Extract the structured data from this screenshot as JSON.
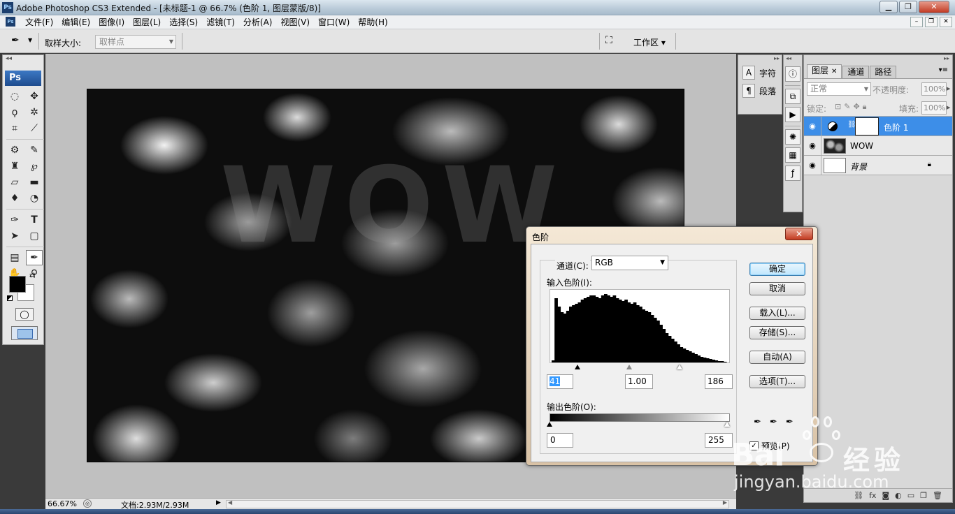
{
  "window": {
    "app_title": "Adobe Photoshop CS3 Extended - [未标题-1 @ 66.7% (色阶 1, 图层蒙版/8)]",
    "ps_logo": "Ps",
    "min": "▁",
    "max": "❐",
    "close": "✕"
  },
  "menu": {
    "items": [
      "文件(F)",
      "编辑(E)",
      "图像(I)",
      "图层(L)",
      "选择(S)",
      "滤镜(T)",
      "分析(A)",
      "视图(V)",
      "窗口(W)",
      "帮助(H)"
    ],
    "doc_min": "–",
    "doc_max": "❐",
    "doc_close": "✕"
  },
  "options": {
    "sample_label": "取样大小:",
    "sample_value": "取样点",
    "workspace_label": "工作区 ▾"
  },
  "toolbox": {
    "ps_badge": "Ps"
  },
  "canvas": {
    "text": "WOW"
  },
  "status": {
    "zoom": "66.67%",
    "doc_size": "文档:2.93M/2.93M"
  },
  "dock": {
    "character": "字符",
    "paragraph": "段落"
  },
  "layers_panel": {
    "tabs": [
      "图层",
      "通道",
      "路径"
    ],
    "blend_mode": "正常",
    "opacity_label": "不透明度:",
    "opacity_value": "100%",
    "lock_label": "锁定:",
    "fill_label": "填充:",
    "fill_value": "100%",
    "layers": [
      {
        "name": "色阶 1"
      },
      {
        "name": "WOW"
      },
      {
        "name": "背景"
      }
    ]
  },
  "levels": {
    "title": "色阶",
    "channel_label": "通道(C):",
    "channel_value": "RGB",
    "input_label": "输入色阶(I):",
    "input_black": "41",
    "input_gamma": "1.00",
    "input_white": "186",
    "output_label": "输出色阶(O):",
    "output_black": "0",
    "output_white": "255",
    "buttons": {
      "ok": "确定",
      "cancel": "取消",
      "load": "载入(L)...",
      "save": "存储(S)...",
      "auto": "自动(A)",
      "options": "选项(T)..."
    },
    "preview_label": "预览(P)",
    "preview_checked": true,
    "histogram": [
      3,
      92,
      80,
      72,
      70,
      74,
      80,
      82,
      84,
      86,
      90,
      92,
      94,
      96,
      96,
      94,
      92,
      96,
      98,
      96,
      94,
      96,
      92,
      90,
      88,
      90,
      86,
      84,
      86,
      82,
      80,
      76,
      74,
      72,
      68,
      64,
      60,
      54,
      48,
      42,
      38,
      34,
      30,
      26,
      22,
      20,
      18,
      16,
      14,
      12,
      10,
      8,
      7,
      6,
      5,
      4,
      3,
      2,
      2,
      1
    ]
  },
  "watermark": {
    "bai": "Bai",
    "cn": "经验",
    "url": "jingyan.baidu.com"
  }
}
